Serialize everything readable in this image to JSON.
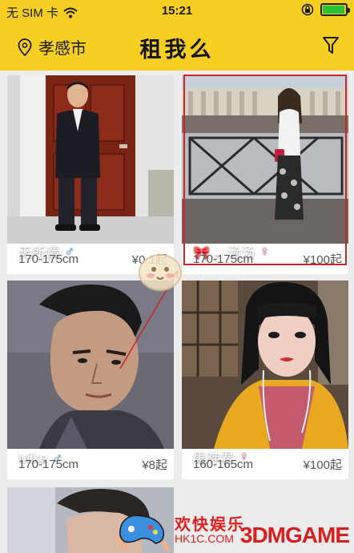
{
  "status": {
    "carrier": "无 SIM 卡",
    "time": "15:21",
    "battery_color": "#27c437",
    "battery_level": 0.95
  },
  "nav": {
    "city": "孝感市",
    "title": "租我么",
    "bg_color": "#f6cf22"
  },
  "cards": [
    {
      "name": "无所谓",
      "gender": "male",
      "height": "170-175cm",
      "price": "¥0.1起"
    },
    {
      "name": "🎀 。汤汤",
      "gender": "female",
      "height": "170-175cm",
      "price": "¥100起"
    },
    {
      "name": "Mike",
      "gender": "male",
      "height": "170-175cm",
      "price": "¥8起"
    },
    {
      "name": "鬼神君",
      "gender": "female",
      "height": "160-165cm",
      "price": "¥100起"
    }
  ],
  "watermark": {
    "cn": "欢快娱乐",
    "url": "HK1C.COM",
    "brand": "3DMGAME"
  },
  "icons": {
    "wifi": "wifi-icon",
    "lock": "rotation-lock-icon",
    "location": "location-pin-icon",
    "filter": "filter-icon"
  }
}
